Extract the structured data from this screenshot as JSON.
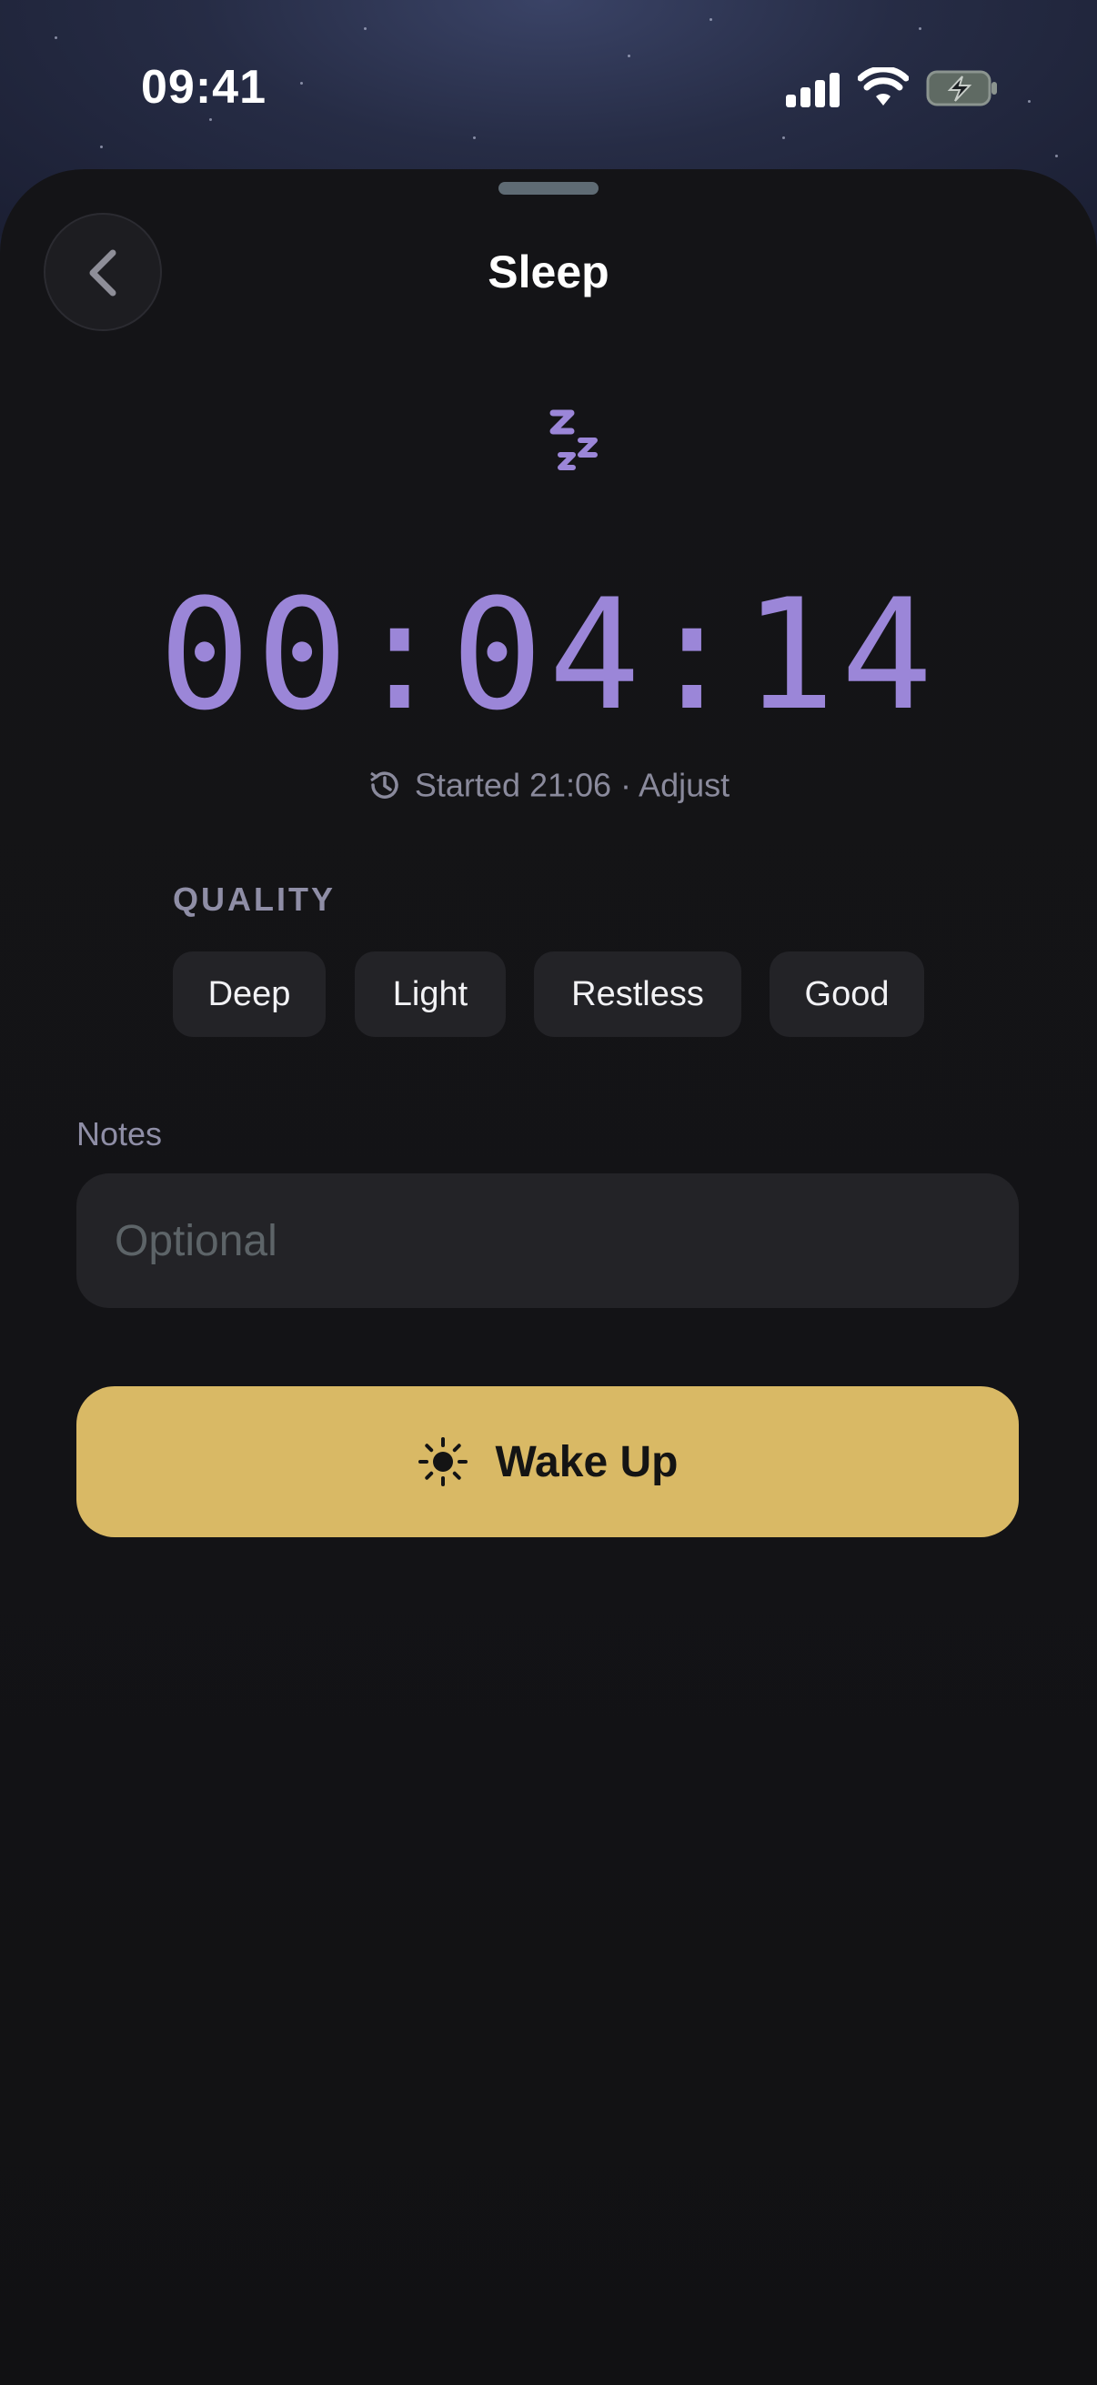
{
  "status_bar": {
    "time": "09:41"
  },
  "header": {
    "title": "Sleep"
  },
  "timer": {
    "elapsed": "00:04:14"
  },
  "started": {
    "text": "Started 21:06 · Adjust"
  },
  "quality": {
    "label": "QUALITY",
    "options": [
      "Deep",
      "Light",
      "Restless",
      "Good"
    ]
  },
  "notes": {
    "label": "Notes",
    "placeholder": "Optional",
    "value": ""
  },
  "wake_button": {
    "label": "Wake Up"
  },
  "colors": {
    "accent": "#9b86d8",
    "wake": "#d9b965",
    "sheet": "#141417"
  },
  "icons": [
    "back-chevron-icon",
    "moon-zzz-icon",
    "history-icon",
    "sun-icon"
  ]
}
